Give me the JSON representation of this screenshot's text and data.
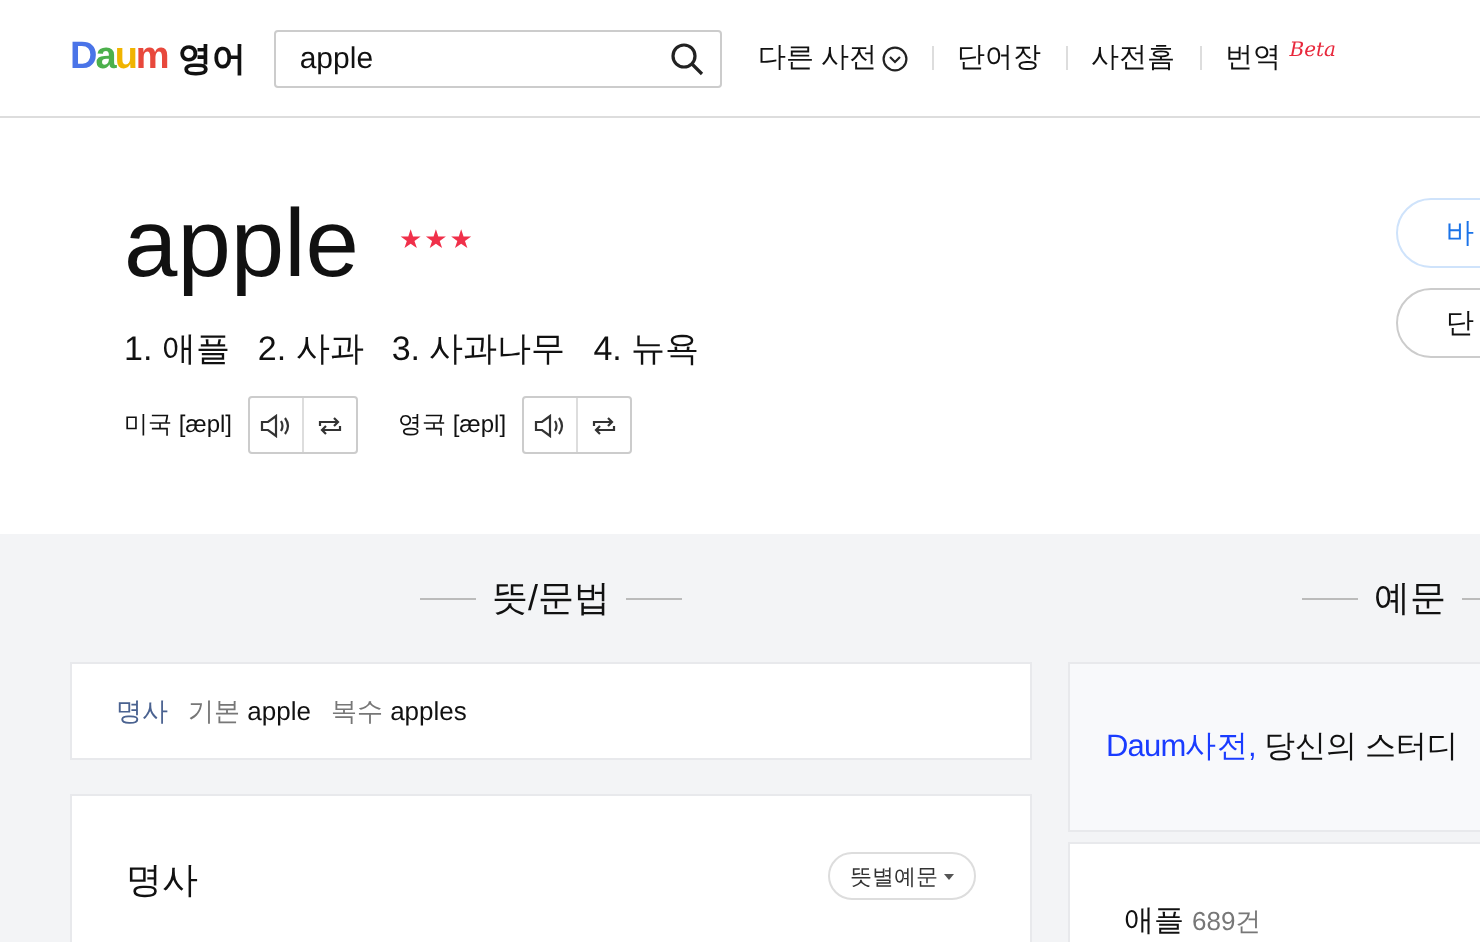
{
  "header": {
    "logo": "Daum",
    "section": "영어",
    "search": {
      "value": "apple"
    },
    "nav": [
      {
        "label": "다른 사전",
        "kind": "dropdown"
      },
      {
        "label": "단어장",
        "kind": "link"
      },
      {
        "label": "사전홈",
        "kind": "link"
      },
      {
        "label": "번역",
        "kind": "beta",
        "badge": "Beta"
      }
    ]
  },
  "word": {
    "title": "apple",
    "stars": 3,
    "meanings": [
      "1. 애플",
      "2. 사과",
      "3. 사과나무",
      "4. 뉴욕"
    ],
    "pronunciations": [
      {
        "label": "미국 [æpl]"
      },
      {
        "label": "영국 [æpl]"
      }
    ],
    "side_buttons": [
      {
        "label": "바",
        "kind": "primary"
      },
      {
        "label": "단",
        "kind": "default"
      }
    ]
  },
  "meaning_section": {
    "heading": "뜻/문법",
    "forms": [
      {
        "kind": "pos",
        "text": "명사"
      },
      {
        "kind": "form",
        "label": "기본",
        "value": "apple"
      },
      {
        "kind": "form",
        "label": "복수",
        "value": "apples"
      }
    ],
    "pos_card": {
      "title": "명사",
      "button": "뜻별예문"
    }
  },
  "example_section": {
    "heading": "예문",
    "promo": {
      "link": "Daum사전,",
      "text": "당신의 스터디"
    },
    "result": {
      "term": "애플",
      "count": "689건"
    }
  }
}
